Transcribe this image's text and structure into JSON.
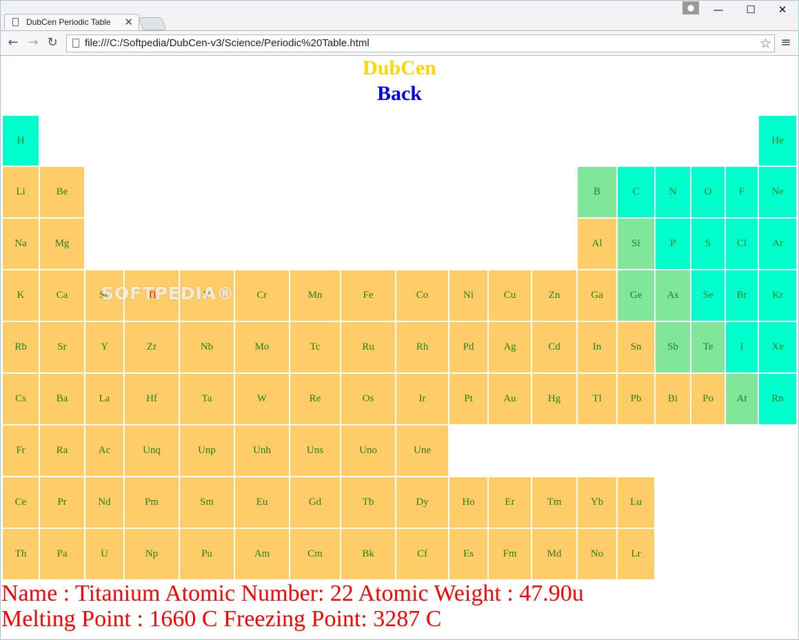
{
  "browser": {
    "tab_title": "DubCen Periodic Table",
    "tab_close": "✕",
    "url": "file:///C:/Softpedia/DubCen-v3/Science/Periodic%20Table.html",
    "back_arrow": "←",
    "forward_arrow": "→",
    "reload_icon": "↻",
    "star_icon": "☆",
    "menu_icon": "≡",
    "user_icon": "●",
    "minimize": "—",
    "maximize": "☐",
    "close": "✕"
  },
  "page": {
    "title": "DubCen",
    "back_label": "Back",
    "watermark": "SOFTPEDIA®",
    "colors": {
      "metal": "#fecd68",
      "nonmetal": "#00ffcc",
      "metalloid": "#80e69a",
      "symbol_text": "#22811f",
      "selected_text": "#ff0000",
      "title": "#ffd700",
      "back": "#0000ee"
    },
    "selected_element": "Ti",
    "info": {
      "line1": "Name : Titanium Atomic Number: 22 Atomic Weight : 47.90u",
      "line2": "Melting Point : 1660 C Freezing Point: 3287 C"
    }
  },
  "periodic_table": {
    "rows": [
      [
        [
          "H",
          "nonmetal"
        ],
        null,
        null,
        null,
        null,
        null,
        null,
        null,
        null,
        null,
        null,
        null,
        null,
        null,
        null,
        null,
        null,
        [
          "He",
          "nonmetal"
        ]
      ],
      [
        [
          "Li",
          "metal"
        ],
        [
          "Be",
          "metal"
        ],
        null,
        null,
        null,
        null,
        null,
        null,
        null,
        null,
        null,
        null,
        [
          "B",
          "metalloid"
        ],
        [
          "C",
          "nonmetal"
        ],
        [
          "N",
          "nonmetal"
        ],
        [
          "O",
          "nonmetal"
        ],
        [
          "F",
          "nonmetal"
        ],
        [
          "Ne",
          "nonmetal"
        ]
      ],
      [
        [
          "Na",
          "metal"
        ],
        [
          "Mg",
          "metal"
        ],
        null,
        null,
        null,
        null,
        null,
        null,
        null,
        null,
        null,
        null,
        [
          "Al",
          "metal"
        ],
        [
          "Si",
          "metalloid"
        ],
        [
          "P",
          "nonmetal"
        ],
        [
          "S",
          "nonmetal"
        ],
        [
          "Cl",
          "nonmetal"
        ],
        [
          "Ar",
          "nonmetal"
        ]
      ],
      [
        [
          "K",
          "metal"
        ],
        [
          "Ca",
          "metal"
        ],
        [
          "Sc",
          "metal"
        ],
        [
          "Ti",
          "metal"
        ],
        [
          "V",
          "metal"
        ],
        [
          "Cr",
          "metal"
        ],
        [
          "Mn",
          "metal"
        ],
        [
          "Fe",
          "metal"
        ],
        [
          "Co",
          "metal"
        ],
        [
          "Ni",
          "metal"
        ],
        [
          "Cu",
          "metal"
        ],
        [
          "Zn",
          "metal"
        ],
        [
          "Ga",
          "metal"
        ],
        [
          "Ge",
          "metalloid"
        ],
        [
          "As",
          "metalloid"
        ],
        [
          "Se",
          "nonmetal"
        ],
        [
          "Br",
          "nonmetal"
        ],
        [
          "Kr",
          "nonmetal"
        ]
      ],
      [
        [
          "Rb",
          "metal"
        ],
        [
          "Sr",
          "metal"
        ],
        [
          "Y",
          "metal"
        ],
        [
          "Zr",
          "metal"
        ],
        [
          "Nb",
          "metal"
        ],
        [
          "Mo",
          "metal"
        ],
        [
          "Tc",
          "metal"
        ],
        [
          "Ru",
          "metal"
        ],
        [
          "Rh",
          "metal"
        ],
        [
          "Pd",
          "metal"
        ],
        [
          "Ag",
          "metal"
        ],
        [
          "Cd",
          "metal"
        ],
        [
          "In",
          "metal"
        ],
        [
          "Sn",
          "metal"
        ],
        [
          "Sb",
          "metalloid"
        ],
        [
          "Te",
          "metalloid"
        ],
        [
          "I",
          "nonmetal"
        ],
        [
          "Xe",
          "nonmetal"
        ]
      ],
      [
        [
          "Cs",
          "metal"
        ],
        [
          "Ba",
          "metal"
        ],
        [
          "La",
          "metal"
        ],
        [
          "Hf",
          "metal"
        ],
        [
          "Ta",
          "metal"
        ],
        [
          "W",
          "metal"
        ],
        [
          "Re",
          "metal"
        ],
        [
          "Os",
          "metal"
        ],
        [
          "Ir",
          "metal"
        ],
        [
          "Pt",
          "metal"
        ],
        [
          "Au",
          "metal"
        ],
        [
          "Hg",
          "metal"
        ],
        [
          "Tl",
          "metal"
        ],
        [
          "Pb",
          "metal"
        ],
        [
          "Bi",
          "metal"
        ],
        [
          "Po",
          "metal"
        ],
        [
          "At",
          "metalloid"
        ],
        [
          "Rn",
          "nonmetal"
        ]
      ],
      [
        [
          "Fr",
          "metal"
        ],
        [
          "Ra",
          "metal"
        ],
        [
          "Ac",
          "metal"
        ],
        [
          "Unq",
          "metal"
        ],
        [
          "Unp",
          "metal"
        ],
        [
          "Unh",
          "metal"
        ],
        [
          "Uns",
          "metal"
        ],
        [
          "Uno",
          "metal"
        ],
        [
          "Une",
          "metal"
        ],
        null,
        null,
        null,
        null,
        null,
        null,
        null,
        null,
        null
      ],
      [
        [
          "Ce",
          "metal"
        ],
        [
          "Pr",
          "metal"
        ],
        [
          "Nd",
          "metal"
        ],
        [
          "Pm",
          "metal"
        ],
        [
          "Sm",
          "metal"
        ],
        [
          "Eu",
          "metal"
        ],
        [
          "Gd",
          "metal"
        ],
        [
          "Tb",
          "metal"
        ],
        [
          "Dy",
          "metal"
        ],
        [
          "Ho",
          "metal"
        ],
        [
          "Er",
          "metal"
        ],
        [
          "Tm",
          "metal"
        ],
        [
          "Yb",
          "metal"
        ],
        [
          "Lu",
          "metal"
        ],
        null,
        null,
        null,
        null
      ],
      [
        [
          "Th",
          "metal"
        ],
        [
          "Pa",
          "metal"
        ],
        [
          "U",
          "metal"
        ],
        [
          "Np",
          "metal"
        ],
        [
          "Pu",
          "metal"
        ],
        [
          "Am",
          "metal"
        ],
        [
          "Cm",
          "metal"
        ],
        [
          "Bk",
          "metal"
        ],
        [
          "Cf",
          "metal"
        ],
        [
          "Es",
          "metal"
        ],
        [
          "Fm",
          "metal"
        ],
        [
          "Md",
          "metal"
        ],
        [
          "No",
          "metal"
        ],
        [
          "Lr",
          "metal"
        ],
        null,
        null,
        null,
        null
      ]
    ]
  }
}
